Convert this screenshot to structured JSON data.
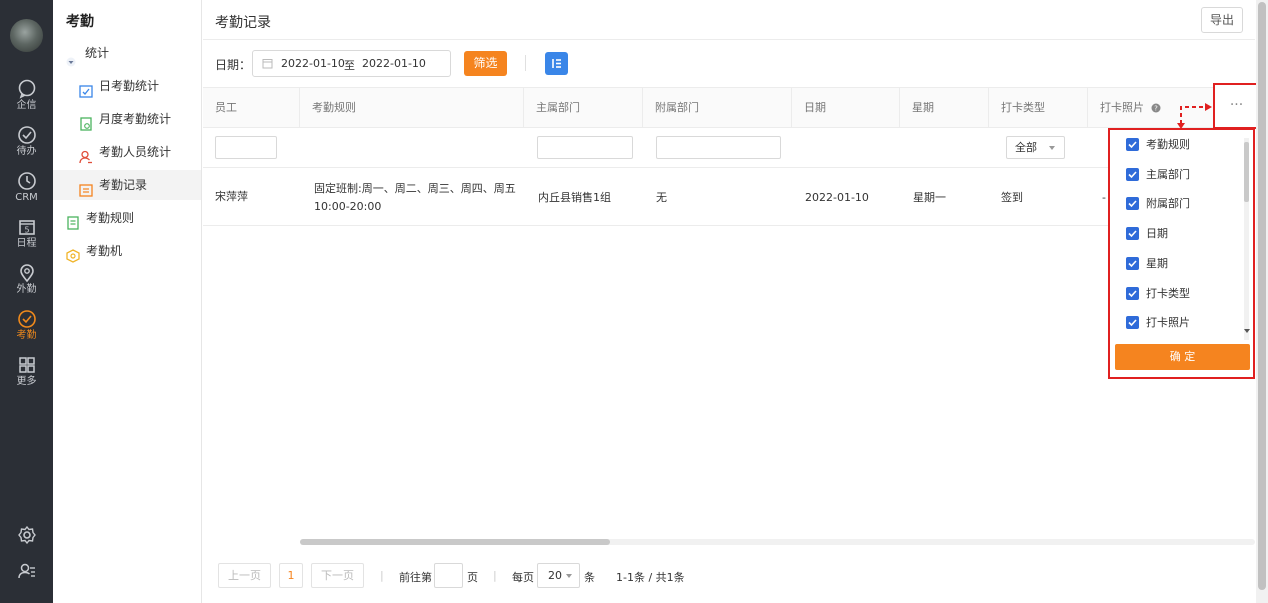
{
  "rail": {
    "items": [
      {
        "label": "企信",
        "icon": "chat-bubble-icon"
      },
      {
        "label": "待办",
        "icon": "check-circle-icon"
      },
      {
        "label": "CRM",
        "icon": "clock-icon"
      },
      {
        "label": "日程",
        "icon": "calendar-icon",
        "day": "5"
      },
      {
        "label": "外勤",
        "icon": "location-pin-icon"
      },
      {
        "label": "考勤",
        "icon": "attendance-icon"
      },
      {
        "label": "更多",
        "icon": "grid-icon"
      }
    ],
    "active": "考勤",
    "active_color": "#f08a1c"
  },
  "menu": {
    "title": "考勤",
    "group": "统计",
    "items": [
      {
        "label": "日考勤统计",
        "icon": "day-stats-icon"
      },
      {
        "label": "月度考勤统计",
        "icon": "month-stats-icon"
      },
      {
        "label": "考勤人员统计",
        "icon": "person-stats-icon"
      },
      {
        "label": "考勤记录",
        "icon": "record-icon",
        "active": true
      },
      {
        "label": "考勤规则",
        "icon": "rules-icon"
      },
      {
        "label": "考勤机",
        "icon": "machine-icon"
      }
    ]
  },
  "main": {
    "title": "考勤记录",
    "export_label": "导出",
    "date_label": "日期：",
    "date_start": "2022-01-10",
    "date_sep": "至",
    "date_end": "2022-01-10",
    "filter_label": "筛选",
    "accent": "#f5841f"
  },
  "table": {
    "columns": [
      "员工",
      "考勤规则",
      "主属部门",
      "附属部门",
      "日期",
      "星期",
      "打卡类型",
      "打卡照片"
    ],
    "more_label": "···",
    "type_filter": "全部",
    "rows": [
      {
        "employee": "宋萍萍",
        "rule_line1": "固定班制:周一、周二、周三、周四、周五",
        "rule_line2": "10:00-20:00",
        "main_dept": "内丘县销售1组",
        "sub_dept": "无",
        "date": "2022-01-10",
        "weekday": "星期一",
        "punch_type": "签到",
        "photo": "-"
      }
    ]
  },
  "column_picker": {
    "options": [
      "考勤规则",
      "主属部门",
      "附属部门",
      "日期",
      "星期",
      "打卡类型",
      "打卡照片"
    ],
    "confirm_label": "确 定",
    "highlight_color": "#e02020",
    "checkbox_color": "#2f6bd9"
  },
  "pager": {
    "prev_label": "上一页",
    "current_page": "1",
    "next_label": "下一页",
    "goto_prefix": "前往第",
    "goto_suffix": "页",
    "per_page_prefix": "每页",
    "per_page_value": "20",
    "per_page_suffix": "条",
    "summary": "1-1条 / 共1条"
  }
}
